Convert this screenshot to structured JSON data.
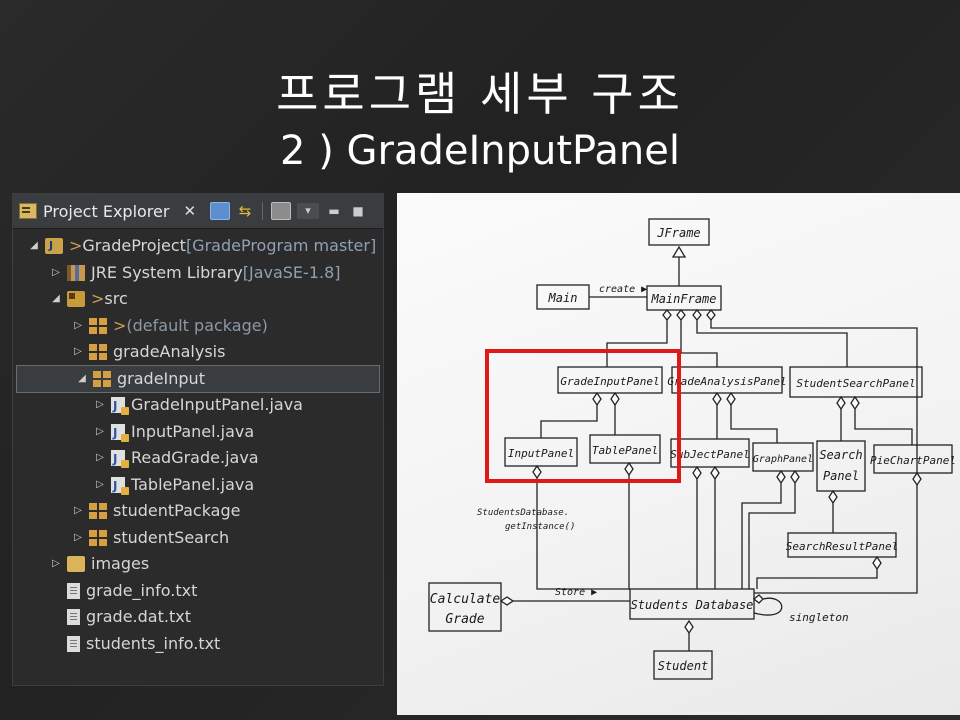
{
  "slide": {
    "title": "프로그램 세부 구조",
    "subtitle": "2 ) GradeInputPanel"
  },
  "explorer": {
    "tab_label": "Project Explorer",
    "close_glyph": "✕",
    "tree": [
      {
        "id": "project",
        "arrow": "◢",
        "icon": "project-icon",
        "prefix": "> ",
        "label": "GradeProject",
        "suffix": " [GradeProgram master]"
      },
      {
        "id": "jre",
        "arrow": "▷",
        "icon": "library-icon",
        "prefix": "",
        "label": "JRE System Library",
        "suffix": " [JavaSE-1.8]"
      },
      {
        "id": "src",
        "arrow": "◢",
        "icon": "source-folder-icon",
        "prefix": "> ",
        "label": "src",
        "suffix": ""
      },
      {
        "id": "default-pkg",
        "arrow": "▷",
        "icon": "package-icon",
        "prefix": "> ",
        "label": "(default package)",
        "suffix": ""
      },
      {
        "id": "gradeAnalysis",
        "arrow": "▷",
        "icon": "package-icon",
        "prefix": "",
        "label": "gradeAnalysis",
        "suffix": ""
      },
      {
        "id": "gradeInput",
        "arrow": "◢",
        "icon": "package-icon",
        "prefix": "",
        "label": "gradeInput",
        "suffix": ""
      },
      {
        "id": "GradeInputPanel",
        "arrow": "▷",
        "icon": "java-file-icon",
        "prefix": "",
        "label": "GradeInputPanel.java",
        "suffix": ""
      },
      {
        "id": "InputPanel",
        "arrow": "▷",
        "icon": "java-file-icon",
        "prefix": "",
        "label": "InputPanel.java",
        "suffix": ""
      },
      {
        "id": "ReadGrade",
        "arrow": "▷",
        "icon": "java-file-icon",
        "prefix": "",
        "label": "ReadGrade.java",
        "suffix": ""
      },
      {
        "id": "TablePanel",
        "arrow": "▷",
        "icon": "java-file-icon",
        "prefix": "",
        "label": "TablePanel.java",
        "suffix": ""
      },
      {
        "id": "studentPackage",
        "arrow": "▷",
        "icon": "package-icon",
        "prefix": "",
        "label": "studentPackage",
        "suffix": ""
      },
      {
        "id": "studentSearch",
        "arrow": "▷",
        "icon": "package-icon",
        "prefix": "",
        "label": "studentSearch",
        "suffix": ""
      },
      {
        "id": "images",
        "arrow": "▷",
        "icon": "folder-icon",
        "prefix": "",
        "label": "images",
        "suffix": ""
      },
      {
        "id": "grade_info",
        "arrow": "",
        "icon": "text-file-icon",
        "prefix": "",
        "label": "grade_info.txt",
        "suffix": ""
      },
      {
        "id": "grade_dat",
        "arrow": "",
        "icon": "text-file-icon",
        "prefix": "",
        "label": "grade.dat.txt",
        "suffix": ""
      },
      {
        "id": "students_info",
        "arrow": "",
        "icon": "text-file-icon",
        "prefix": "",
        "label": "students_info.txt",
        "suffix": ""
      }
    ],
    "selected": "gradeInput"
  },
  "diagram": {
    "highlight_color": "#e01818",
    "classes": {
      "jframe": "JFrame",
      "main": "Main",
      "mainframe": "MainFrame",
      "gradeinputpanel": "GradeInputPanel",
      "gradeanalysispanel": "GradeAnalysisPanel",
      "studentsearchpanel": "StudentSearchPanel",
      "inputpanel": "InputPanel",
      "tablepanel": "TablePanel",
      "subjectpanel": "SubJectPanel",
      "graphpanel": "GraphPanel",
      "searchpanel_1": "Search",
      "searchpanel_2": "Panel",
      "piechartpanel": "PieChartPanel",
      "searchresultpanel": "SearchResultPanel",
      "calculategrade_1": "Calculate",
      "calculategrade_2": "Grade",
      "studentsdatabase": "Students Database",
      "student": "Student"
    },
    "labels": {
      "create": "create ▶",
      "store": "Store ▶",
      "singleton": "singleton",
      "getinstance_1": "StudentsDatabase.",
      "getinstance_2": "getInstance()"
    }
  }
}
